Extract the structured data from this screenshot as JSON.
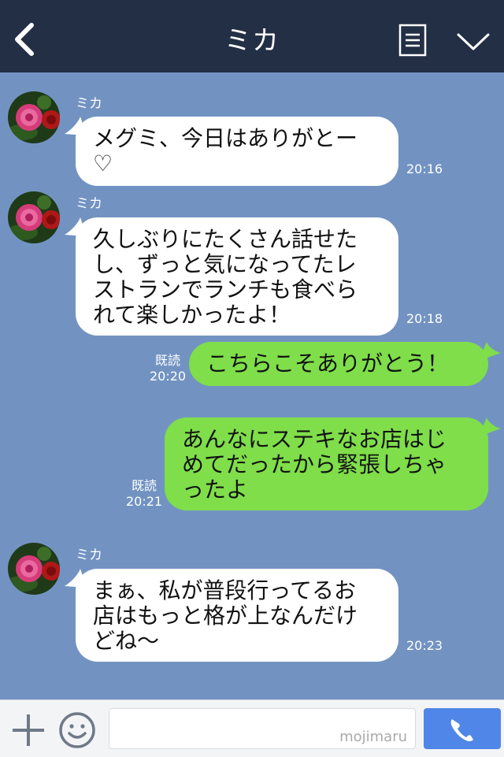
{
  "header": {
    "title": "ミカ"
  },
  "messages": [
    {
      "sender": "ミカ",
      "lines": [
        "メグミ、今日はありがとー",
        "♡"
      ],
      "time": "20:16"
    },
    {
      "sender": "ミカ",
      "lines": [
        "久しぶりにたくさん話せた",
        "し、ずっと気になってたレ",
        "ストランでランチも食べら",
        "れて楽しかったよ！"
      ],
      "time": "20:18"
    },
    {
      "lines": [
        "こちらこそありがとう！"
      ],
      "read": "既読",
      "time": "20:20"
    },
    {
      "lines": [
        "あんなにステキなお店はじ",
        "めてだったから緊張しちゃ",
        "ったよ"
      ],
      "read": "既読",
      "time": "20:21"
    },
    {
      "sender": "ミカ",
      "lines": [
        "まぁ、私が普段行ってるお",
        "店はもっと格が上なんだけ",
        "どね〜"
      ],
      "time": "20:23"
    }
  ],
  "footer": {
    "watermark": "mojimaru"
  }
}
